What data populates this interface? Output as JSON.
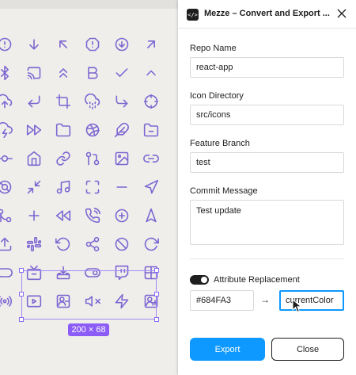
{
  "canvas": {
    "icon_color": "#7c66d1",
    "selection_color": "#8b5cf6",
    "selection_size": "200 × 68",
    "icons": [
      "alert-circle-icon",
      "arrow-down-icon",
      "arrow-up-left-icon",
      "alert-octagon-icon",
      "arrow-down-circle-icon",
      "arrow-up-right-icon",
      "bluetooth-icon",
      "cast-icon",
      "chevrons-up-icon",
      "bold-icon",
      "check-icon",
      "chevron-up-icon",
      "cloud-upload-icon",
      "corner-down-left-icon",
      "crop-icon",
      "cloud-drizzle-icon",
      "corner-down-right-icon",
      "crosshair-icon",
      "cloud-lightning-icon",
      "fast-forward-icon",
      "folder-icon",
      "dribbble-icon",
      "feather-icon",
      "folder-minus-icon",
      "git-commit-icon",
      "home-icon",
      "link-icon",
      "git-pull-request-icon",
      "image-icon",
      "link-2-icon",
      "life-buoy-icon",
      "minimize-icon",
      "music-icon",
      "maximize-icon",
      "minus-icon",
      "navigation-icon",
      "git-merge-icon",
      "plus-icon",
      "rewind-icon",
      "phone-call-icon",
      "plus-circle-icon",
      "navigation-2-icon",
      "upload-icon",
      "slack-icon",
      "rotate-ccw-icon",
      "share-icon",
      "slash-icon",
      "rotate-cw-icon",
      "toggle-icon",
      "tv-icon",
      "download-tray-icon",
      "toggle-right-icon",
      "twitch-icon",
      "grid-icon",
      "radio-icon",
      "youtube-icon",
      "user-minus-icon",
      "volume-x-icon",
      "zap-icon",
      "user-plus-icon"
    ]
  },
  "plugin": {
    "logo_glyph": "</>",
    "title": "Mezze – Convert and Export ...",
    "repo": {
      "label": "Repo Name",
      "value": "react-app"
    },
    "icon_dir": {
      "label": "Icon Directory",
      "value": "src/icons"
    },
    "branch": {
      "label": "Feature Branch",
      "value": "test"
    },
    "commit": {
      "label": "Commit Message",
      "value": "Test update"
    },
    "attribute_replacement": {
      "label": "Attribute Replacement",
      "enabled": true,
      "from": "#684FA3",
      "arrow": "→",
      "to": "currentColor"
    },
    "export_label": "Export",
    "close_label": "Close",
    "accent": "#0d99ff"
  }
}
